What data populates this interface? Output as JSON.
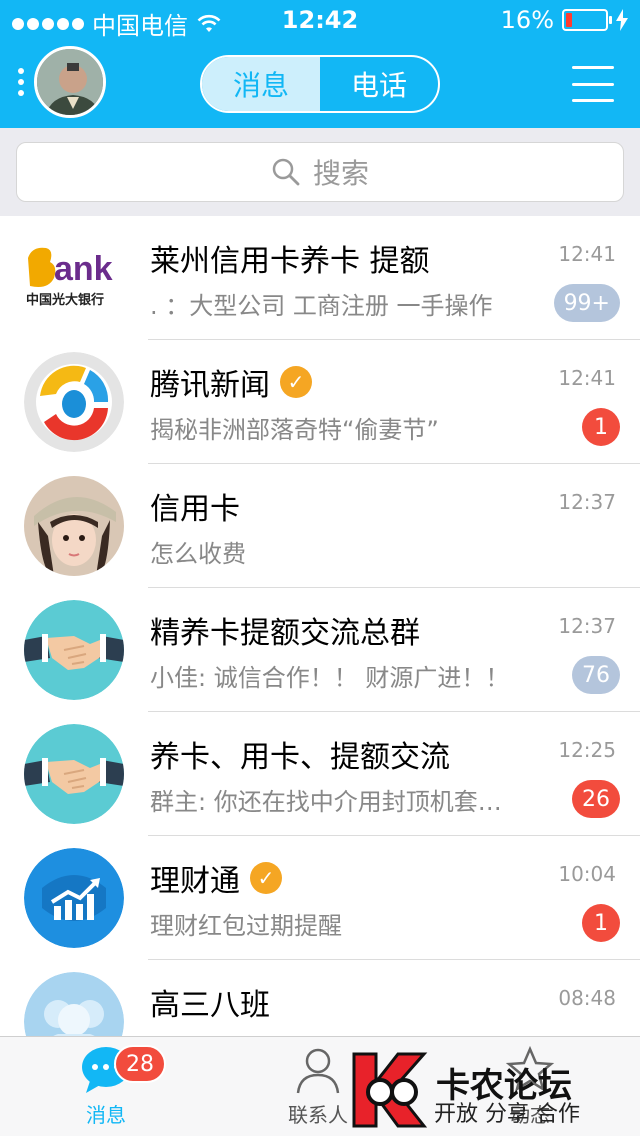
{
  "status_bar": {
    "carrier": "中国电信",
    "time": "12:42",
    "battery": "16%",
    "battery_level": 0.16
  },
  "header": {
    "tabs": [
      "消息",
      "电话"
    ],
    "active_tab": "消息"
  },
  "search": {
    "placeholder": "搜索"
  },
  "conversations": [
    {
      "name": "莱州信用卡养卡  提额",
      "time": "12:41",
      "preview": ". ：大型公司 工商注册 一手操作",
      "badge": "99+",
      "badge_color": "#b4c5dc",
      "verified": false,
      "avatar": "bank-logo"
    },
    {
      "name": "腾讯新闻",
      "time": "12:41",
      "preview": "揭秘非洲部落奇特“偷妻节”",
      "badge": "1",
      "badge_color": "#f24c3d",
      "verified": true,
      "avatar": "tencent-news-logo"
    },
    {
      "name": "信用卡",
      "time": "12:37",
      "preview": "怎么收费",
      "badge": "",
      "verified": false,
      "avatar": "girl-photo"
    },
    {
      "name": "精养卡提额交流总群",
      "time": "12:37",
      "preview": "小佳: 诚信合作！！ 财源广进！！",
      "badge": "76",
      "badge_color": "#b4c5dc",
      "verified": false,
      "avatar": "handshake"
    },
    {
      "name": "养卡、用卡、提额交流",
      "time": "12:25",
      "preview": "群主: 你还在找中介用封顶机套…",
      "badge": "26",
      "badge_color": "#f24c3d",
      "verified": false,
      "avatar": "handshake"
    },
    {
      "name": "理财通",
      "time": "10:04",
      "preview": "理财红包过期提醒",
      "badge": "1",
      "badge_color": "#f24c3d",
      "verified": true,
      "avatar": "chart-logo"
    },
    {
      "name": "高三八班",
      "time": "08:48",
      "preview": "",
      "badge": "",
      "verified": false,
      "avatar": "group-silhouette"
    }
  ],
  "tab_bar": {
    "messages": {
      "label": "消息",
      "badge": "28"
    },
    "contacts": {
      "label": "联系人"
    },
    "dynamics": {
      "label": "动态"
    }
  },
  "watermark": {
    "title": "卡农论坛",
    "subtitle": "开放 分享 合作"
  }
}
